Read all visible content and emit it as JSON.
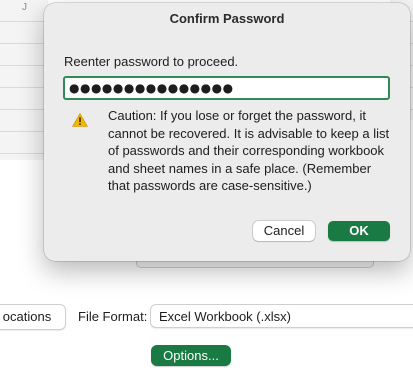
{
  "background": {
    "column_letter": "J",
    "locations_button_label": "ocations",
    "file_format_label": "File Format:",
    "file_format_value": "Excel Workbook (.xlsx)",
    "options_button_label": "Options..."
  },
  "dialog": {
    "title": "Confirm Password",
    "prompt": "Reenter password to proceed.",
    "password_value": "●●●●●●●●●●●●●●●",
    "caution_icon": "warning-triangle-icon",
    "caution_text": "Caution: If you lose or forget the password, it cannot be recovered. It is advisable to keep a list of passwords and their corresponding workbook and sheet names in a safe place. (Remember that passwords are case-sensitive.)",
    "cancel_label": "Cancel",
    "ok_label": "OK"
  },
  "colors": {
    "accent": "#1a7a44",
    "focus_ring": "#2f8a58",
    "warning": "#f2b600"
  }
}
